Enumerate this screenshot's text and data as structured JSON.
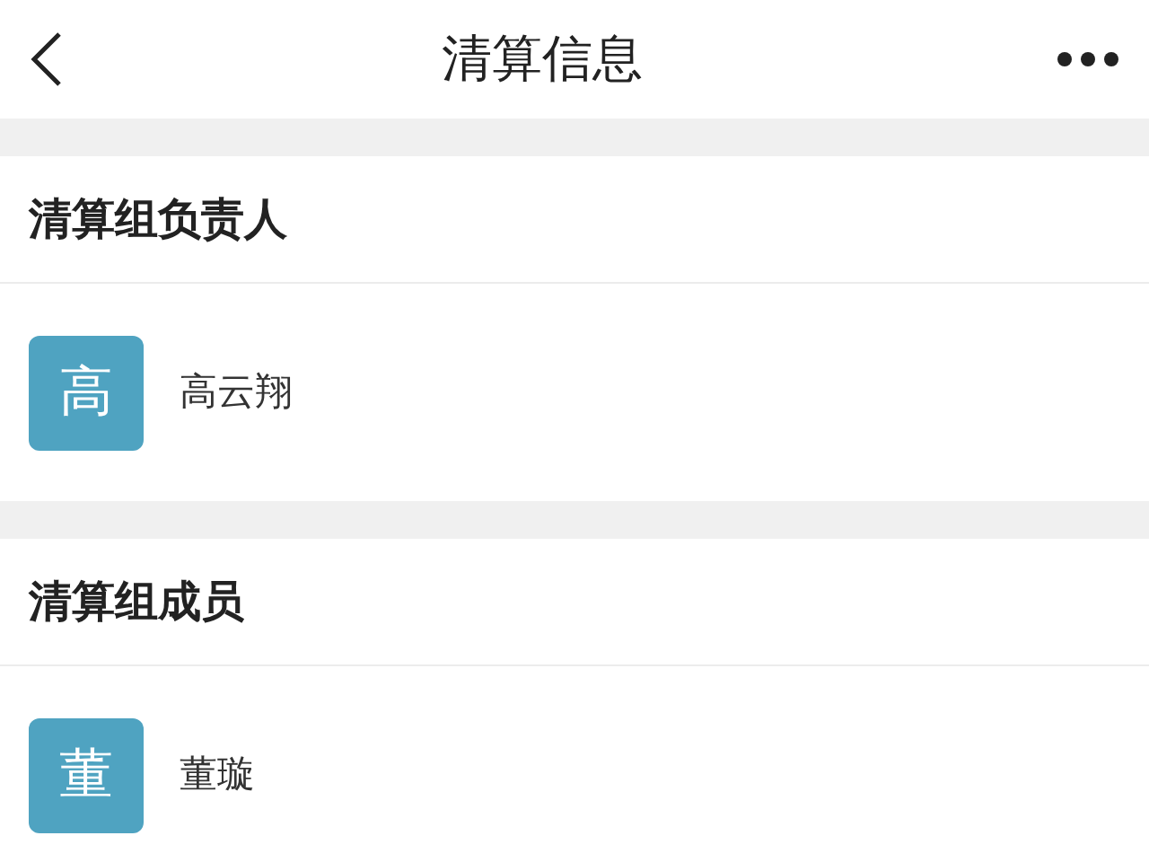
{
  "nav_bar": {
    "title": "清算信息"
  },
  "sections": [
    {
      "heading": "清算组负责人",
      "people": [
        {
          "avatar": "高",
          "name": "高云翔"
        }
      ]
    },
    {
      "heading": "清算组成员",
      "people": [
        {
          "avatar": "董",
          "name": "董璇"
        }
      ]
    }
  ]
}
